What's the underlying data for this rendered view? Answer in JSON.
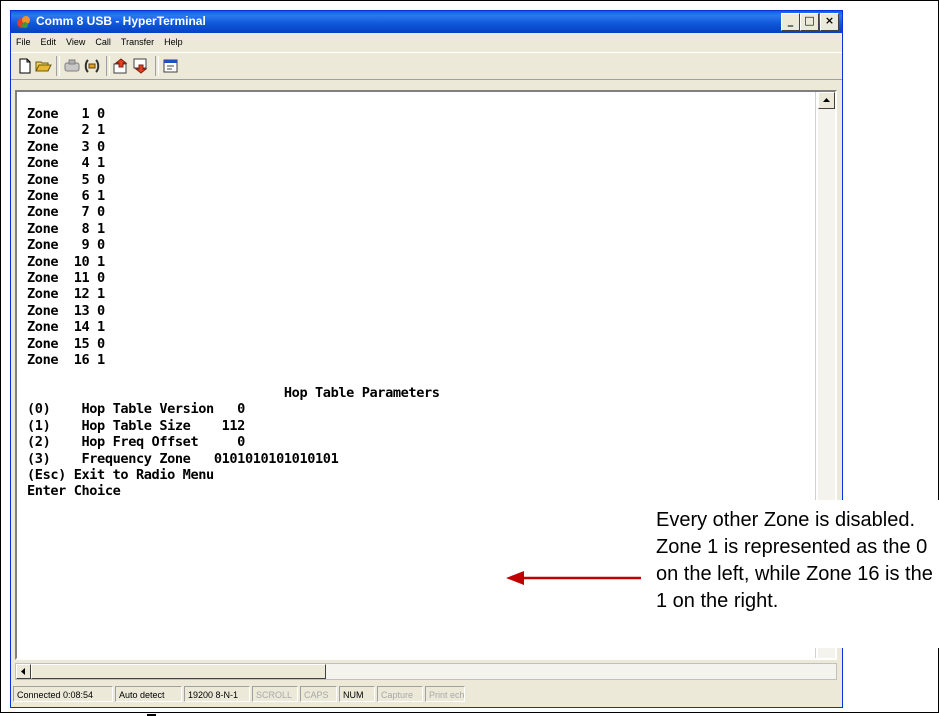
{
  "window": {
    "title": "Comm 8 USB - HyperTerminal",
    "controls": {
      "minimize": "_",
      "maximize": "□",
      "close": "×"
    }
  },
  "menu": [
    "File",
    "Edit",
    "View",
    "Call",
    "Transfer",
    "Help"
  ],
  "toolbar": [
    "new-icon",
    "open-icon",
    "disconnect-icon",
    "connect-icon",
    "send-icon",
    "receive-icon",
    "properties-icon"
  ],
  "terminal": {
    "text": "Zone   1 0\nZone   2 1\nZone   3 0\nZone   4 1\nZone   5 0\nZone   6 1\nZone   7 0\nZone   8 1\nZone   9 0\nZone  10 1\nZone  11 0\nZone  12 1\nZone  13 0\nZone  14 1\nZone  15 0\nZone  16 1\n\n                                 Hop Table Parameters\n(0)    Hop Table Version   0\n(1)    Hop Table Size    112\n(2)    Hop Freq Offset     0\n(3)    Frequency Zone   0101010101010101\n(Esc) Exit to Radio Menu\nEnter Choice "
  },
  "status": {
    "connected": "Connected 0:08:54",
    "detect": "Auto detect",
    "settings": "19200 8-N-1",
    "scroll": "SCROLL",
    "caps": "CAPS",
    "num": "NUM",
    "capture": "Capture",
    "print": "Print echo"
  },
  "annotation": {
    "text": "Every other Zone is disabled. Zone 1 is represented as the 0 on the left, while Zone 16 is the 1 on the right.",
    "arrow_color": "#C00000"
  }
}
